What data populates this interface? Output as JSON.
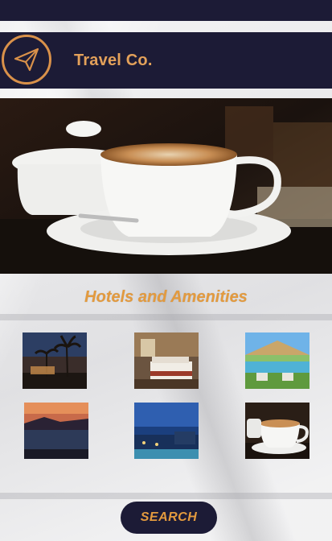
{
  "header": {
    "brand": "Travel Co.",
    "logo_icon": "paper-plane-icon"
  },
  "hero": {
    "image": "coffee-cup-photo"
  },
  "section": {
    "title": "Hotels and Amenities"
  },
  "gallery": {
    "items": [
      {
        "name": "palm-trees-resort-photo"
      },
      {
        "name": "hotel-bedroom-photo"
      },
      {
        "name": "pool-cabana-photo"
      },
      {
        "name": "sunset-shoreline-photo"
      },
      {
        "name": "night-resort-photo"
      },
      {
        "name": "coffee-cup-photo"
      }
    ]
  },
  "actions": {
    "search_label": "SEARCH"
  },
  "colors": {
    "navy": "#1c1b36",
    "accent": "#e39a3e",
    "logo_ring": "#d9914a"
  }
}
